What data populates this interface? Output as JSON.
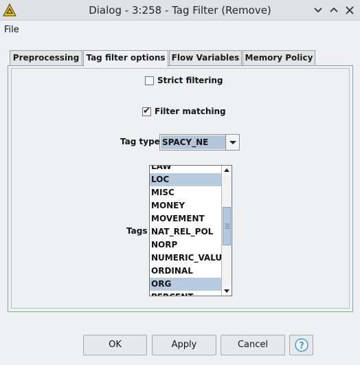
{
  "window": {
    "title": "Dialog - 3:258 - Tag Filter (Remove)",
    "icon": "knime-warning-triangle-icon"
  },
  "menu": {
    "file": "File"
  },
  "tabs": [
    {
      "label": "Preprocessing",
      "active": false
    },
    {
      "label": "Tag filter options",
      "active": true
    },
    {
      "label": "Flow Variables",
      "active": false
    },
    {
      "label": "Memory Policy",
      "active": false
    }
  ],
  "options": {
    "strict_filtering": {
      "label": "Strict filtering",
      "checked": false
    },
    "filter_matching": {
      "label": "Filter matching",
      "checked": true,
      "check_glyph": "✔"
    },
    "tag_type": {
      "label": "Tag type",
      "value": "SPACY_NE"
    },
    "tags": {
      "label": "Tags",
      "items": [
        {
          "text": "LAW",
          "selected": false
        },
        {
          "text": "LOC",
          "selected": true
        },
        {
          "text": "MISC",
          "selected": false
        },
        {
          "text": "MONEY",
          "selected": false
        },
        {
          "text": "MOVEMENT",
          "selected": false
        },
        {
          "text": "NAT_REL_POL",
          "selected": false
        },
        {
          "text": "NORP",
          "selected": false
        },
        {
          "text": "NUMERIC_VALUE",
          "selected": false
        },
        {
          "text": "ORDINAL",
          "selected": false
        },
        {
          "text": "ORG",
          "selected": true
        },
        {
          "text": "PERCENT",
          "selected": false
        }
      ]
    }
  },
  "buttons": {
    "ok": "OK",
    "apply": "Apply",
    "cancel": "Cancel",
    "help": "?"
  },
  "colors": {
    "selection": "#b8cbde",
    "panel_border": "#7ea2c4",
    "help_accent": "#3d9ae0",
    "icon_yellow": "#f5c400"
  }
}
